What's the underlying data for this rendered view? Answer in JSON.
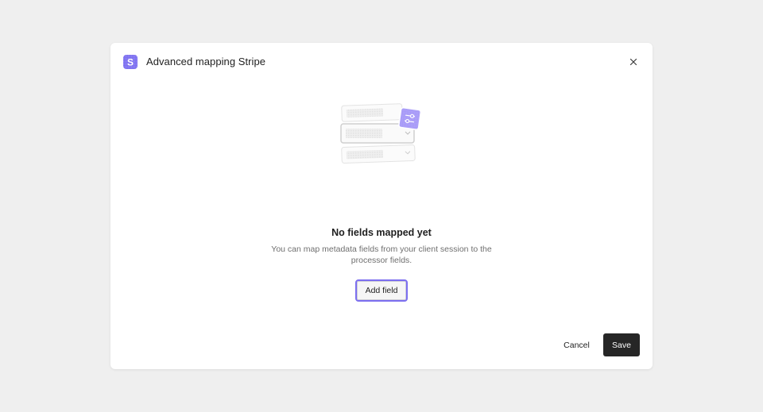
{
  "dialog": {
    "title": "Advanced mapping Stripe",
    "close_icon": "close-icon",
    "brand_icon": "stripe-logo-icon",
    "brand_letter": "S",
    "brand_color": "#7c6ff0"
  },
  "empty_state": {
    "illustration_icon": "mapping-fields-illustration",
    "title": "No fields mapped yet",
    "description": "You can map metadata fields from your client session to the processor fields."
  },
  "actions": {
    "add_field_label": "Add field",
    "cancel_label": "Cancel",
    "save_label": "Save"
  },
  "colors": {
    "accent": "#7c6ff0",
    "primary_button_bg": "#262626",
    "page_bg": "#efefef",
    "muted_text": "#6f6f6f"
  }
}
